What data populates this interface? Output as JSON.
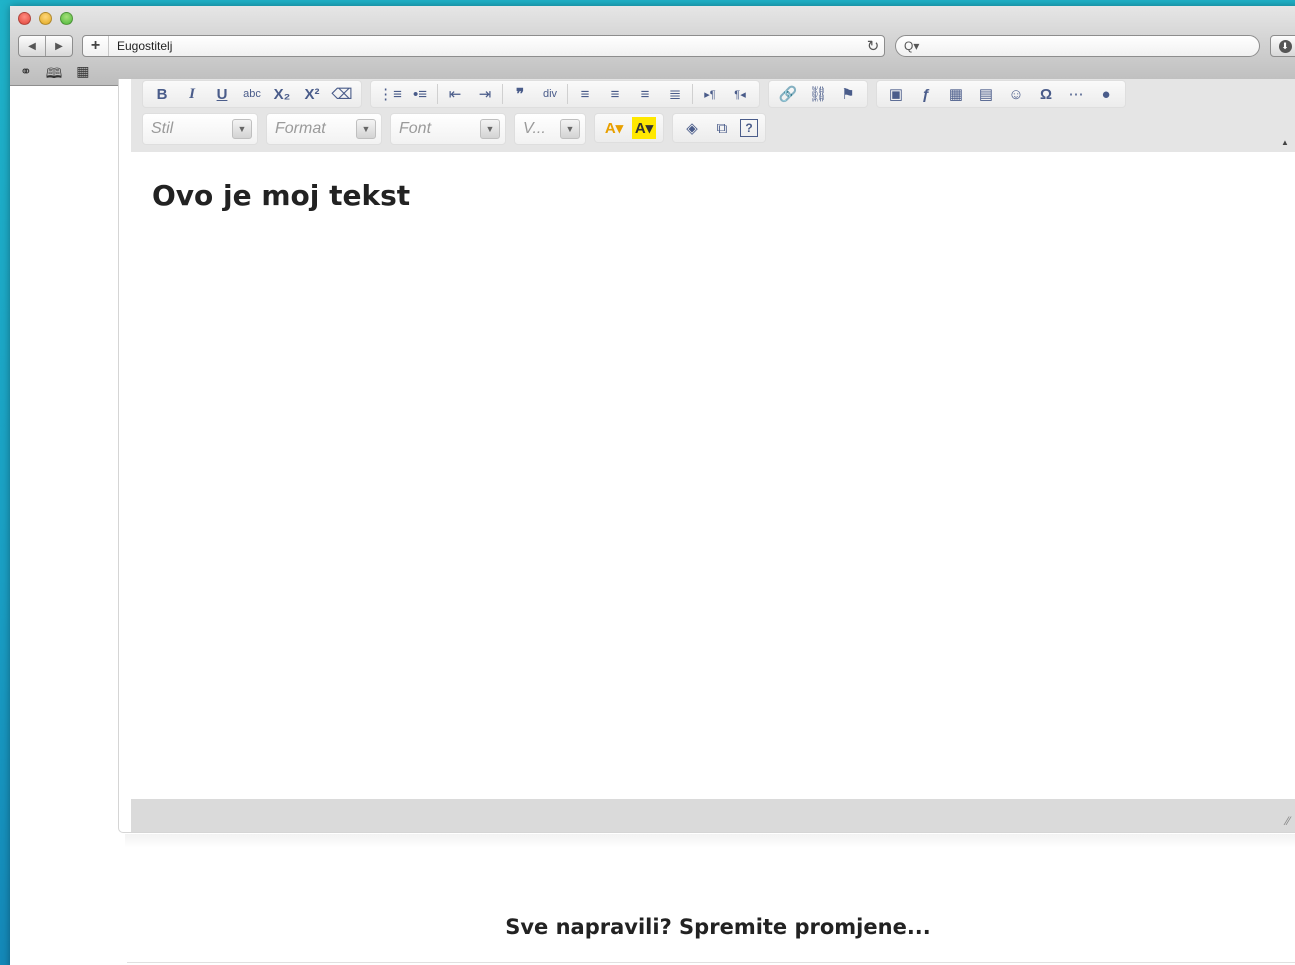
{
  "browser": {
    "url": "Eugostitelj",
    "add_tab_symbol": "+",
    "back_symbol": "◀",
    "forward_symbol": "▶",
    "reload_symbol": "↻",
    "search_symbol": "Q▾",
    "downloads_symbol": "⬇",
    "bookmarks": [
      "reading-list-icon",
      "book-icon",
      "top-sites-icon"
    ]
  },
  "toolbar": {
    "row1": [
      [
        {
          "name": "bold-button",
          "label": "B",
          "cls": "b"
        },
        {
          "name": "italic-button",
          "label": "I",
          "cls": "i"
        },
        {
          "name": "underline-button",
          "label": "U",
          "cls": "u"
        },
        {
          "name": "strikethrough-button",
          "label": "abc",
          "cls": "small"
        },
        {
          "name": "subscript-button",
          "label": "X₂",
          "cls": "b"
        },
        {
          "name": "superscript-button",
          "label": "X²",
          "cls": "b"
        },
        {
          "name": "remove-format-button",
          "label": "⌫",
          "cls": ""
        }
      ],
      [
        {
          "name": "numbered-list-button",
          "label": "⋮≡",
          "cls": ""
        },
        {
          "name": "bulleted-list-button",
          "label": "•≡",
          "cls": ""
        },
        {
          "name": "sep",
          "label": "",
          "cls": ""
        },
        {
          "name": "outdent-button",
          "label": "⇤",
          "cls": ""
        },
        {
          "name": "indent-button",
          "label": "⇥",
          "cls": ""
        },
        {
          "name": "sep",
          "label": "",
          "cls": ""
        },
        {
          "name": "blockquote-button",
          "label": "❞",
          "cls": "b"
        },
        {
          "name": "create-div-button",
          "label": "div",
          "cls": "small"
        },
        {
          "name": "sep",
          "label": "",
          "cls": ""
        },
        {
          "name": "align-left-button",
          "label": "≡",
          "cls": ""
        },
        {
          "name": "align-center-button",
          "label": "≡",
          "cls": ""
        },
        {
          "name": "align-right-button",
          "label": "≡",
          "cls": ""
        },
        {
          "name": "align-justify-button",
          "label": "≣",
          "cls": ""
        },
        {
          "name": "sep",
          "label": "",
          "cls": ""
        },
        {
          "name": "ltr-button",
          "label": "▸¶",
          "cls": "small"
        },
        {
          "name": "rtl-button",
          "label": "¶◂",
          "cls": "small"
        }
      ],
      [
        {
          "name": "link-icon-button",
          "label": "🔗",
          "cls": ""
        },
        {
          "name": "unlink-button",
          "label": "⛓",
          "cls": ""
        },
        {
          "name": "anchor-flag-button",
          "label": "⚑",
          "cls": ""
        }
      ],
      [
        {
          "name": "image-button",
          "label": "▣",
          "cls": ""
        },
        {
          "name": "flash-button",
          "label": "ƒ",
          "cls": "b"
        },
        {
          "name": "table-button",
          "label": "▦",
          "cls": ""
        },
        {
          "name": "horizontal-rule-button",
          "label": "▤",
          "cls": ""
        },
        {
          "name": "smiley-button",
          "label": "☺",
          "cls": ""
        },
        {
          "name": "special-char-button",
          "label": "Ω",
          "cls": "b"
        },
        {
          "name": "page-break-button",
          "label": "⋯",
          "cls": ""
        },
        {
          "name": "iframe-button",
          "label": "●",
          "cls": ""
        }
      ]
    ],
    "combos": [
      {
        "name": "style-select",
        "label": "Stil",
        "width": 116
      },
      {
        "name": "format-select",
        "label": "Format",
        "width": 116
      },
      {
        "name": "font-select",
        "label": "Font",
        "width": 116
      },
      {
        "name": "size-select",
        "label": "V...",
        "width": 72
      }
    ],
    "color_buttons": [
      "A▾",
      "A▾"
    ],
    "tools": [
      "maximize-icon",
      "show-blocks-icon",
      "help-icon"
    ],
    "tools_labels": [
      "◈",
      "⧉",
      "?"
    ]
  },
  "editor": {
    "content_heading": "Ovo je moj tekst"
  },
  "footer": {
    "save_message": "Sve napravili? Spremite promjene..."
  }
}
